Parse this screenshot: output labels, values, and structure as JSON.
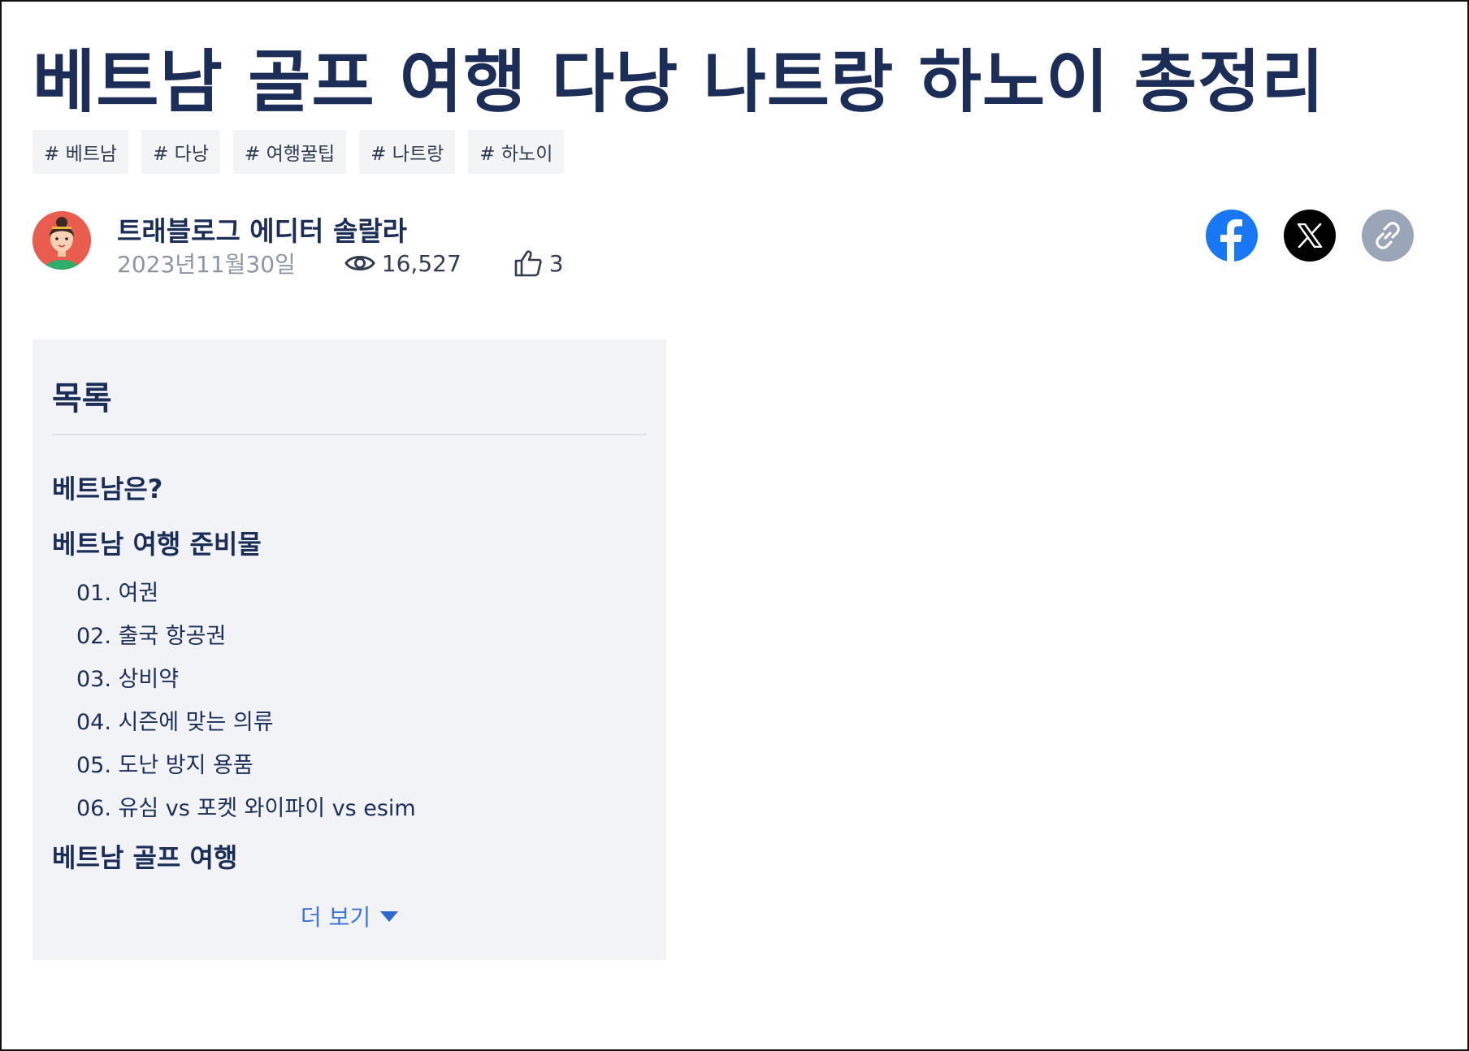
{
  "article": {
    "title": "베트남 골프 여행 다낭 나트랑 하노이 총정리",
    "tags": [
      "# 베트남",
      "# 다낭",
      "# 여행꿀팁",
      "# 나트랑",
      "# 하노이"
    ]
  },
  "author": {
    "name": "트래블로그 에디터 솔랄라",
    "date": "2023년11월30일",
    "views": "16,527",
    "likes": "3"
  },
  "share": {
    "icons": [
      "facebook-icon",
      "x-icon",
      "link-icon"
    ],
    "colors": {
      "facebook": "#1877f2",
      "x": "#000000",
      "link": "#9aa5b8"
    }
  },
  "toc": {
    "title": "목록",
    "items": [
      {
        "level": 1,
        "text": "베트남은?"
      },
      {
        "level": 1,
        "text": "베트남 여행 준비물"
      },
      {
        "level": 2,
        "text": "01. 여권"
      },
      {
        "level": 2,
        "text": "02. 출국 항공권"
      },
      {
        "level": 2,
        "text": "03. 상비약"
      },
      {
        "level": 2,
        "text": "04. 시즌에 맞는 의류"
      },
      {
        "level": 2,
        "text": "05. 도난 방지 용품"
      },
      {
        "level": 2,
        "text": "06. 유심 vs 포켓 와이파이 vs esim"
      },
      {
        "level": 1,
        "text": "베트남 골프 여행"
      }
    ],
    "more_label": "더 보기"
  }
}
